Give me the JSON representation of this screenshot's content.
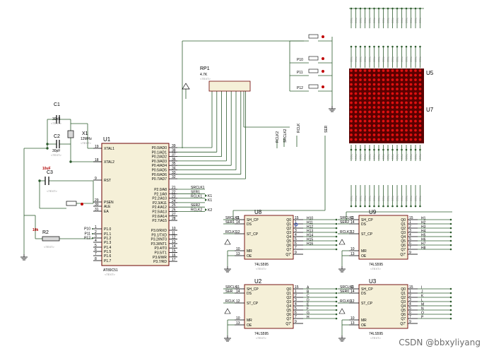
{
  "mcu": {
    "ref": "U1",
    "part": "AT89C51",
    "tag": "<TEXT>",
    "left_pins": [
      {
        "num": "19",
        "name": "XTAL1"
      },
      {
        "num": "18",
        "name": "XTAL2"
      },
      {
        "num": "9",
        "name": "RST"
      },
      {
        "num": "29",
        "name": "PSEN"
      },
      {
        "num": "30",
        "name": "ALE"
      },
      {
        "num": "31",
        "name": "EA"
      },
      {
        "num": "1",
        "name": "P1.0"
      },
      {
        "num": "2",
        "name": "P1.1"
      },
      {
        "num": "3",
        "name": "P1.2"
      },
      {
        "num": "4",
        "name": "P1.3"
      },
      {
        "num": "5",
        "name": "P1.4"
      },
      {
        "num": "6",
        "name": "P1.5"
      },
      {
        "num": "7",
        "name": "P1.6"
      },
      {
        "num": "8",
        "name": "P1.7"
      }
    ],
    "right_pins": [
      {
        "num": "39",
        "name": "P0.0/AD0"
      },
      {
        "num": "38",
        "name": "P0.1/AD1"
      },
      {
        "num": "37",
        "name": "P0.2/AD2"
      },
      {
        "num": "36",
        "name": "P0.3/AD3"
      },
      {
        "num": "35",
        "name": "P0.4/AD4"
      },
      {
        "num": "34",
        "name": "P0.5/AD5"
      },
      {
        "num": "33",
        "name": "P0.6/AD6"
      },
      {
        "num": "32",
        "name": "P0.7/AD7"
      },
      {
        "num": "21",
        "name": "P2.0/A8"
      },
      {
        "num": "22",
        "name": "P2.1/A9"
      },
      {
        "num": "23",
        "name": "P2.2/A10"
      },
      {
        "num": "24",
        "name": "P2.3/A11"
      },
      {
        "num": "25",
        "name": "P2.4/A12"
      },
      {
        "num": "26",
        "name": "P2.5/A13"
      },
      {
        "num": "27",
        "name": "P2.6/A14"
      },
      {
        "num": "28",
        "name": "P2.7/A15"
      },
      {
        "num": "10",
        "name": "P3.0/RXD"
      },
      {
        "num": "11",
        "name": "P3.1/TXD"
      },
      {
        "num": "12",
        "name": "P3.2/INT0"
      },
      {
        "num": "13",
        "name": "P3.3/INT1"
      },
      {
        "num": "14",
        "name": "P3.4/T0"
      },
      {
        "num": "15",
        "name": "P3.5/T1"
      },
      {
        "num": "16",
        "name": "P3.6/WR"
      },
      {
        "num": "17",
        "name": "P3.7/RD"
      }
    ],
    "p2_nets": [
      "SRCLK1",
      "SER1",
      "RCLK1",
      "",
      "SER2",
      "RCLK2"
    ],
    "p1_nets": [
      "P10",
      "P11",
      "P12"
    ]
  },
  "caps": [
    {
      "ref": "C1",
      "value": "30pF",
      "tag": "<TEXT>"
    },
    {
      "ref": "C2",
      "value": "30pF",
      "tag": "<TEXT>"
    },
    {
      "ref": "C3",
      "value": "10uF",
      "tag": "<TEXT>"
    }
  ],
  "crystal": {
    "ref": "X1",
    "value": "12MHz",
    "tag": "<TEXT>"
  },
  "resistor": {
    "ref": "R2",
    "value": "10k",
    "tag": "<TEXT>"
  },
  "rpack": {
    "ref": "RP1",
    "value": "4.7K",
    "tag": "<TEXT>"
  },
  "button_labels": [
    "",
    "P10",
    "P11",
    "P12"
  ],
  "net_labels": {
    "rclk2": "RCLK2",
    "srclk2": "SRCLK2",
    "rclk": "RCLK",
    "ser": "SER"
  },
  "matrix": {
    "ref_top": "U5",
    "ref_bottom": "U7"
  },
  "shift_registers": [
    {
      "ref": "U8",
      "part": "74LS595",
      "tag": "<TEXT>",
      "in_nets": [
        "SRCLK1",
        "SER1",
        "RCLK1"
      ],
      "out_nets": [
        "H10",
        "H11",
        "H12",
        "H13",
        "H14",
        "H15",
        "H16",
        ""
      ]
    },
    {
      "ref": "U9",
      "part": "74LS595",
      "tag": "<TEXT>",
      "in_nets": [
        "SRCLK2",
        "SER2",
        "RCLK2"
      ],
      "out_nets": [
        "H1",
        "H2",
        "H3",
        "H4",
        "H5",
        "H6",
        "H7",
        "H8"
      ]
    },
    {
      "ref": "U2",
      "part": "74LS595",
      "tag": "<TEXT>",
      "in_nets": [
        "SRCLK",
        "SER",
        "RCLK"
      ],
      "out_nets": [
        "A",
        "B",
        "C",
        "D",
        "E",
        "F",
        "G",
        "H"
      ]
    },
    {
      "ref": "U3",
      "part": "74LS595",
      "tag": "<TEXT>",
      "in_nets": [
        "SRCLK0",
        "SER0",
        "RCLK0"
      ],
      "out_nets": [
        "I",
        "J",
        "K",
        "L",
        "M",
        "N",
        "O",
        "P"
      ]
    }
  ],
  "ic_pins": {
    "left": [
      {
        "num": "11",
        "name": "SH_CP"
      },
      {
        "num": "14",
        "name": "DS"
      },
      {
        "num": "12",
        "name": "ST_CP"
      },
      {
        "num": "10",
        "name": "MR"
      },
      {
        "num": "13",
        "name": "OE"
      }
    ],
    "right": [
      {
        "num": "15",
        "name": "Q0"
      },
      {
        "num": "1",
        "name": "Q1"
      },
      {
        "num": "2",
        "name": "Q2"
      },
      {
        "num": "3",
        "name": "Q3"
      },
      {
        "num": "4",
        "name": "Q4"
      },
      {
        "num": "5",
        "name": "Q5"
      },
      {
        "num": "6",
        "name": "Q6"
      },
      {
        "num": "7",
        "name": "Q7"
      },
      {
        "num": "9",
        "name": "Q7'"
      }
    ]
  },
  "watermark": "CSDN @bbxyliyang"
}
